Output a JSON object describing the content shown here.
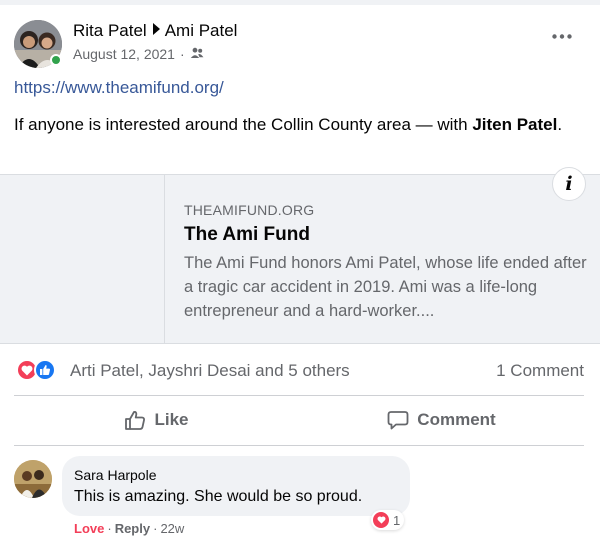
{
  "post": {
    "author": "Rita Patel",
    "target": "Ami Patel",
    "date": "August 12, 2021",
    "privacy_icon": "friends-icon",
    "link": "https://www.theamifund.org/",
    "text": "If anyone is interested around the Collin County area — with ",
    "tagged": "Jiten Patel",
    "text_end": "."
  },
  "preview": {
    "domain": "THEAMIFUND.ORG",
    "title": "The Ami Fund",
    "description": "The Ami Fund honors Ami Patel, whose life ended after a tragic car accident in 2019. Ami was a life-long entrepreneur and a hard-worker....",
    "info_glyph": "i"
  },
  "reactions": {
    "names": "Arti Patel, Jayshri Desai and 5 others",
    "comments": "1 Comment",
    "love_color": "#f33e58",
    "like_color": "#1877f2"
  },
  "actions": {
    "like": "Like",
    "comment": "Comment"
  },
  "comment": {
    "author": "Sara Harpole",
    "text": "This is amazing. She would be so proud.",
    "reaction_count": "1",
    "love_label": "Love",
    "reply_label": "Reply",
    "time": "22w"
  }
}
